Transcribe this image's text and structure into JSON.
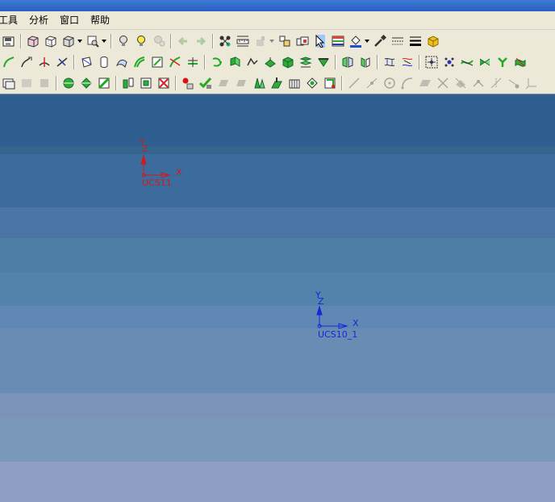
{
  "menu": [
    "工具",
    "分析",
    "窗口",
    "帮助"
  ],
  "colors": {
    "ucs_red": "#d11a1a",
    "ucs_blue": "#1428d6",
    "viewport_top": "#2e5f90",
    "viewport_bottom": "#8e9ec4"
  },
  "viewport": {
    "csys": [
      {
        "label": "UCS11",
        "x_axis": "X",
        "y_axis": "Y",
        "z_axis": "Z",
        "color": "#d11a1a"
      },
      {
        "label": "UCS10_1",
        "x_axis": "X",
        "y_axis": "Y",
        "z_axis": "Z",
        "color": "#1428d6"
      }
    ]
  }
}
